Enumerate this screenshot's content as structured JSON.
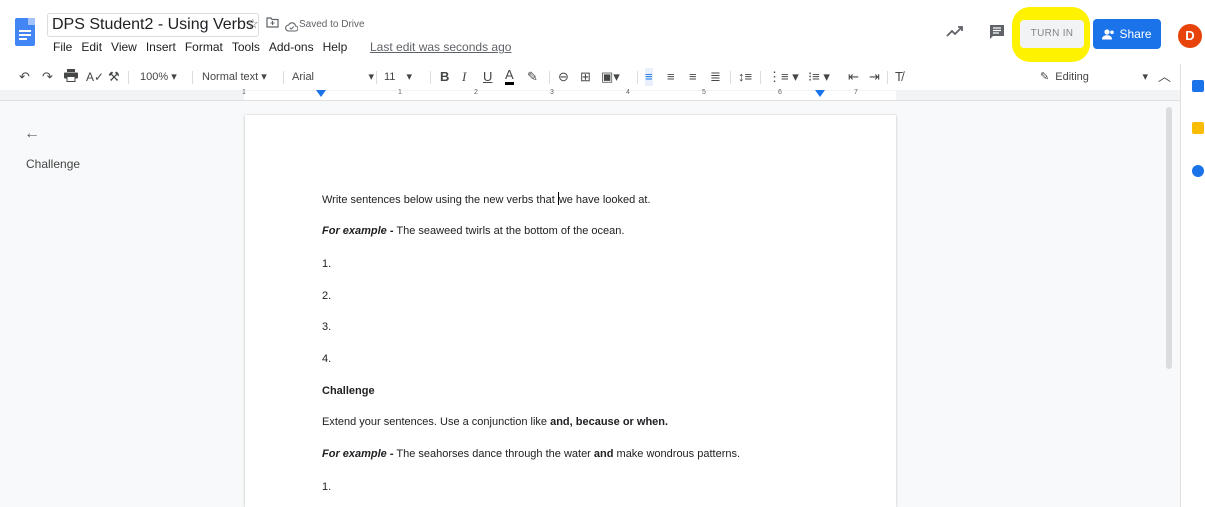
{
  "header": {
    "doc_title": "DPS Student2 - Using Verbs",
    "saved_status": "Saved to Drive",
    "menu": [
      "File",
      "Edit",
      "View",
      "Insert",
      "Format",
      "Tools",
      "Add-ons",
      "Help"
    ],
    "last_edit": "Last edit was seconds ago",
    "turn_in_label": "TURN IN",
    "share_label": "Share",
    "avatar_initial": "D"
  },
  "toolbar": {
    "zoom": "100%",
    "style": "Normal text",
    "font": "Arial",
    "font_size": "11",
    "mode": "Editing"
  },
  "ruler": {
    "numbers": [
      "1",
      "1",
      "2",
      "3",
      "4",
      "5",
      "6",
      "7"
    ]
  },
  "outline": {
    "heading": "Challenge"
  },
  "document": {
    "line1_before": "Write sentences below using the new verbs that ",
    "line1_after": "we have looked at.",
    "example1_label": "For example -",
    "example1_text": " The seaweed twirls at the bottom of the ocean.",
    "numbered": [
      "1.",
      "2.",
      "3.",
      "4."
    ],
    "challenge_heading": "Challenge",
    "extend_text": "Extend your sentences. Use a conjunction like ",
    "extend_bold": "and, because or when.",
    "example2_label": "For example -",
    "example2_text_a": " The seahorses dance through the water ",
    "example2_bold": "and",
    "example2_text_b": " make wondrous patterns.",
    "last_number": "1."
  },
  "colors": {
    "accent": "#1a73e8",
    "highlight": "#fff200",
    "avatar": "#e8430a"
  },
  "icons": [
    "docs-logo-icon",
    "star-icon",
    "move-folder-icon",
    "cloud-saved-icon",
    "trending-icon",
    "comment-icon",
    "undo-icon",
    "redo-icon",
    "print-icon",
    "spellcheck-icon",
    "paint-format-icon",
    "bold-icon",
    "italic-icon",
    "underline-icon",
    "text-color-icon",
    "highlight-icon",
    "link-icon",
    "add-comment-icon",
    "insert-image-icon",
    "align-left-icon",
    "align-center-icon",
    "align-right-icon",
    "justify-icon",
    "line-spacing-icon",
    "numbered-list-icon",
    "bulleted-list-icon",
    "decrease-indent-icon",
    "increase-indent-icon",
    "clear-formatting-icon",
    "pencil-icon",
    "back-arrow-icon",
    "calendar-icon",
    "keep-icon",
    "tasks-icon"
  ]
}
